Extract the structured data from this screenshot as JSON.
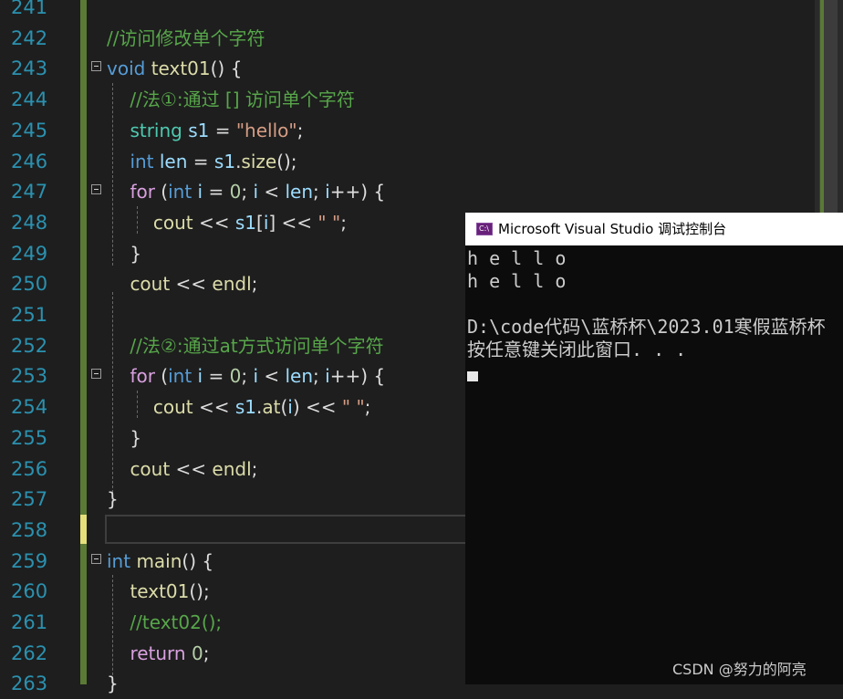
{
  "editor": {
    "lines": [
      {
        "num": "241",
        "segs": []
      },
      {
        "num": "242",
        "segs": [
          {
            "t": "//访问修改单个字符",
            "c": "c-com"
          }
        ]
      },
      {
        "num": "243",
        "segs": [
          {
            "t": "void",
            "c": "c-kw"
          },
          {
            "t": " ",
            "c": ""
          },
          {
            "t": "text01",
            "c": "c-fn"
          },
          {
            "t": "() {",
            "c": ""
          }
        ]
      },
      {
        "num": "244",
        "segs": [
          {
            "t": "    //法①:通过 [] 访问单个字符",
            "c": "c-com"
          }
        ]
      },
      {
        "num": "245",
        "segs": [
          {
            "t": "    ",
            "c": ""
          },
          {
            "t": "string",
            "c": "c-ty"
          },
          {
            "t": " ",
            "c": ""
          },
          {
            "t": "s1",
            "c": "c-var"
          },
          {
            "t": " = ",
            "c": ""
          },
          {
            "t": "\"hello\"",
            "c": "c-str"
          },
          {
            "t": ";",
            "c": ""
          }
        ]
      },
      {
        "num": "246",
        "segs": [
          {
            "t": "    ",
            "c": ""
          },
          {
            "t": "int",
            "c": "c-kw"
          },
          {
            "t": " ",
            "c": ""
          },
          {
            "t": "len",
            "c": "c-var"
          },
          {
            "t": " = ",
            "c": ""
          },
          {
            "t": "s1",
            "c": "c-var"
          },
          {
            "t": ".",
            "c": ""
          },
          {
            "t": "size",
            "c": "c-fn"
          },
          {
            "t": "();",
            "c": ""
          }
        ]
      },
      {
        "num": "247",
        "segs": [
          {
            "t": "    ",
            "c": ""
          },
          {
            "t": "for",
            "c": "c-kw2"
          },
          {
            "t": " (",
            "c": ""
          },
          {
            "t": "int",
            "c": "c-kw"
          },
          {
            "t": " ",
            "c": ""
          },
          {
            "t": "i",
            "c": "c-var"
          },
          {
            "t": " = ",
            "c": ""
          },
          {
            "t": "0",
            "c": "c-num"
          },
          {
            "t": "; ",
            "c": ""
          },
          {
            "t": "i",
            "c": "c-var"
          },
          {
            "t": " < ",
            "c": ""
          },
          {
            "t": "len",
            "c": "c-var"
          },
          {
            "t": "; ",
            "c": ""
          },
          {
            "t": "i",
            "c": "c-var"
          },
          {
            "t": "++) {",
            "c": ""
          }
        ]
      },
      {
        "num": "248",
        "segs": [
          {
            "t": "        ",
            "c": ""
          },
          {
            "t": "cout",
            "c": "c-fn"
          },
          {
            "t": " << ",
            "c": ""
          },
          {
            "t": "s1",
            "c": "c-var"
          },
          {
            "t": "[",
            "c": ""
          },
          {
            "t": "i",
            "c": "c-var"
          },
          {
            "t": "] << ",
            "c": ""
          },
          {
            "t": "\" \"",
            "c": "c-str"
          },
          {
            "t": ";",
            "c": ""
          }
        ]
      },
      {
        "num": "249",
        "segs": [
          {
            "t": "    }",
            "c": ""
          }
        ]
      },
      {
        "num": "250",
        "segs": [
          {
            "t": "    ",
            "c": ""
          },
          {
            "t": "cout",
            "c": "c-fn"
          },
          {
            "t": " << ",
            "c": ""
          },
          {
            "t": "endl",
            "c": "c-fn"
          },
          {
            "t": ";",
            "c": ""
          }
        ]
      },
      {
        "num": "251",
        "segs": []
      },
      {
        "num": "252",
        "segs": [
          {
            "t": "    //法②:通过at方式访问单个字符",
            "c": "c-com"
          }
        ]
      },
      {
        "num": "253",
        "segs": [
          {
            "t": "    ",
            "c": ""
          },
          {
            "t": "for",
            "c": "c-kw2"
          },
          {
            "t": " (",
            "c": ""
          },
          {
            "t": "int",
            "c": "c-kw"
          },
          {
            "t": " ",
            "c": ""
          },
          {
            "t": "i",
            "c": "c-var"
          },
          {
            "t": " = ",
            "c": ""
          },
          {
            "t": "0",
            "c": "c-num"
          },
          {
            "t": "; ",
            "c": ""
          },
          {
            "t": "i",
            "c": "c-var"
          },
          {
            "t": " < ",
            "c": ""
          },
          {
            "t": "len",
            "c": "c-var"
          },
          {
            "t": "; ",
            "c": ""
          },
          {
            "t": "i",
            "c": "c-var"
          },
          {
            "t": "++) {",
            "c": ""
          }
        ]
      },
      {
        "num": "254",
        "segs": [
          {
            "t": "        ",
            "c": ""
          },
          {
            "t": "cout",
            "c": "c-fn"
          },
          {
            "t": " << ",
            "c": ""
          },
          {
            "t": "s1",
            "c": "c-var"
          },
          {
            "t": ".",
            "c": ""
          },
          {
            "t": "at",
            "c": "c-fn"
          },
          {
            "t": "(",
            "c": ""
          },
          {
            "t": "i",
            "c": "c-var"
          },
          {
            "t": ") << ",
            "c": ""
          },
          {
            "t": "\" \"",
            "c": "c-str"
          },
          {
            "t": ";",
            "c": ""
          }
        ]
      },
      {
        "num": "255",
        "segs": [
          {
            "t": "    }",
            "c": ""
          }
        ]
      },
      {
        "num": "256",
        "segs": [
          {
            "t": "    ",
            "c": ""
          },
          {
            "t": "cout",
            "c": "c-fn"
          },
          {
            "t": " << ",
            "c": ""
          },
          {
            "t": "endl",
            "c": "c-fn"
          },
          {
            "t": ";",
            "c": ""
          }
        ]
      },
      {
        "num": "257",
        "segs": [
          {
            "t": "}",
            "c": ""
          }
        ]
      },
      {
        "num": "258",
        "segs": []
      },
      {
        "num": "259",
        "segs": [
          {
            "t": "int",
            "c": "c-kw"
          },
          {
            "t": " ",
            "c": ""
          },
          {
            "t": "main",
            "c": "c-fn"
          },
          {
            "t": "() {",
            "c": ""
          }
        ]
      },
      {
        "num": "260",
        "segs": [
          {
            "t": "    ",
            "c": ""
          },
          {
            "t": "text01",
            "c": "c-fn"
          },
          {
            "t": "();",
            "c": ""
          }
        ]
      },
      {
        "num": "261",
        "segs": [
          {
            "t": "    //text02();",
            "c": "c-com"
          }
        ]
      },
      {
        "num": "262",
        "segs": [
          {
            "t": "    ",
            "c": ""
          },
          {
            "t": "return",
            "c": "c-kw2"
          },
          {
            "t": " ",
            "c": ""
          },
          {
            "t": "0",
            "c": "c-num"
          },
          {
            "t": ";",
            "c": ""
          }
        ]
      },
      {
        "num": "263",
        "segs": [
          {
            "t": "}",
            "c": ""
          }
        ]
      }
    ],
    "fold_lines": [
      "243",
      "247",
      "253",
      "259"
    ]
  },
  "console": {
    "title": "Microsoft Visual Studio 调试控制台",
    "icon_label": "C:\\",
    "lines": [
      "h e l l o",
      "h e l l o",
      "",
      "D:\\code代码\\蓝桥杯\\2023.01寒假蓝桥杯",
      "按任意键关闭此窗口. . ."
    ]
  },
  "watermark": "CSDN @努力的阿亮",
  "colors": {
    "background": "#1e1e1e",
    "line_number": "#2b91af",
    "comment": "#57a64a",
    "keyword": "#569cd6",
    "control_keyword": "#d8a0df",
    "type": "#4ec9b0",
    "function": "#dcdcaa",
    "string": "#d69d85",
    "variable": "#9cdcfe",
    "number": "#b5cea8",
    "change_bar": "#5a7a35",
    "console_bg": "#0c0c0c"
  }
}
